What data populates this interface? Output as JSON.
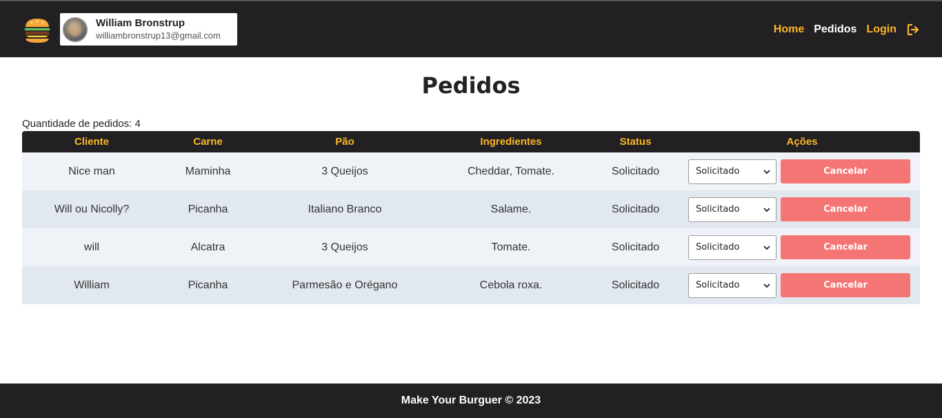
{
  "user": {
    "name": "William Bronstrup",
    "email": "williambronstrup13@gmail.com"
  },
  "nav": {
    "home": "Home",
    "pedidos": "Pedidos",
    "login": "Login"
  },
  "page": {
    "title": "Pedidos",
    "count_label": "Quantidade de pedidos: ",
    "count_value": "4"
  },
  "table": {
    "headers": [
      "Cliente",
      "Carne",
      "Pão",
      "Ingredientes",
      "Status",
      "Ações"
    ],
    "rows": [
      {
        "cliente": "Nice man",
        "carne": "Maminha",
        "pao": "3 Queijos",
        "ingredientes": "Cheddar, Tomate.",
        "status": "Solicitado",
        "select_value": "Solicitado",
        "cancel_label": "Cancelar"
      },
      {
        "cliente": "Will ou Nicolly?",
        "carne": "Picanha",
        "pao": "Italiano Branco",
        "ingredientes": "Salame.",
        "status": "Solicitado",
        "select_value": "Solicitado",
        "cancel_label": "Cancelar"
      },
      {
        "cliente": "will",
        "carne": "Alcatra",
        "pao": "3 Queijos",
        "ingredientes": "Tomate.",
        "status": "Solicitado",
        "select_value": "Solicitado",
        "cancel_label": "Cancelar"
      },
      {
        "cliente": "William",
        "carne": "Picanha",
        "pao": "Parmesão e Orégano",
        "ingredientes": "Cebola roxa.",
        "status": "Solicitado",
        "select_value": "Solicitado",
        "cancel_label": "Cancelar"
      }
    ]
  },
  "footer": {
    "text": "Make Your Burguer © 2023"
  },
  "icons": {
    "logo": "burger-icon",
    "logout": "logout-icon",
    "select": "chevron-down-icon"
  },
  "colors": {
    "navbar": "#222022",
    "accent": "#fcb827",
    "cancel": "#f57474",
    "row_odd": "#eff3f8",
    "row_even": "#e2e8f0"
  }
}
